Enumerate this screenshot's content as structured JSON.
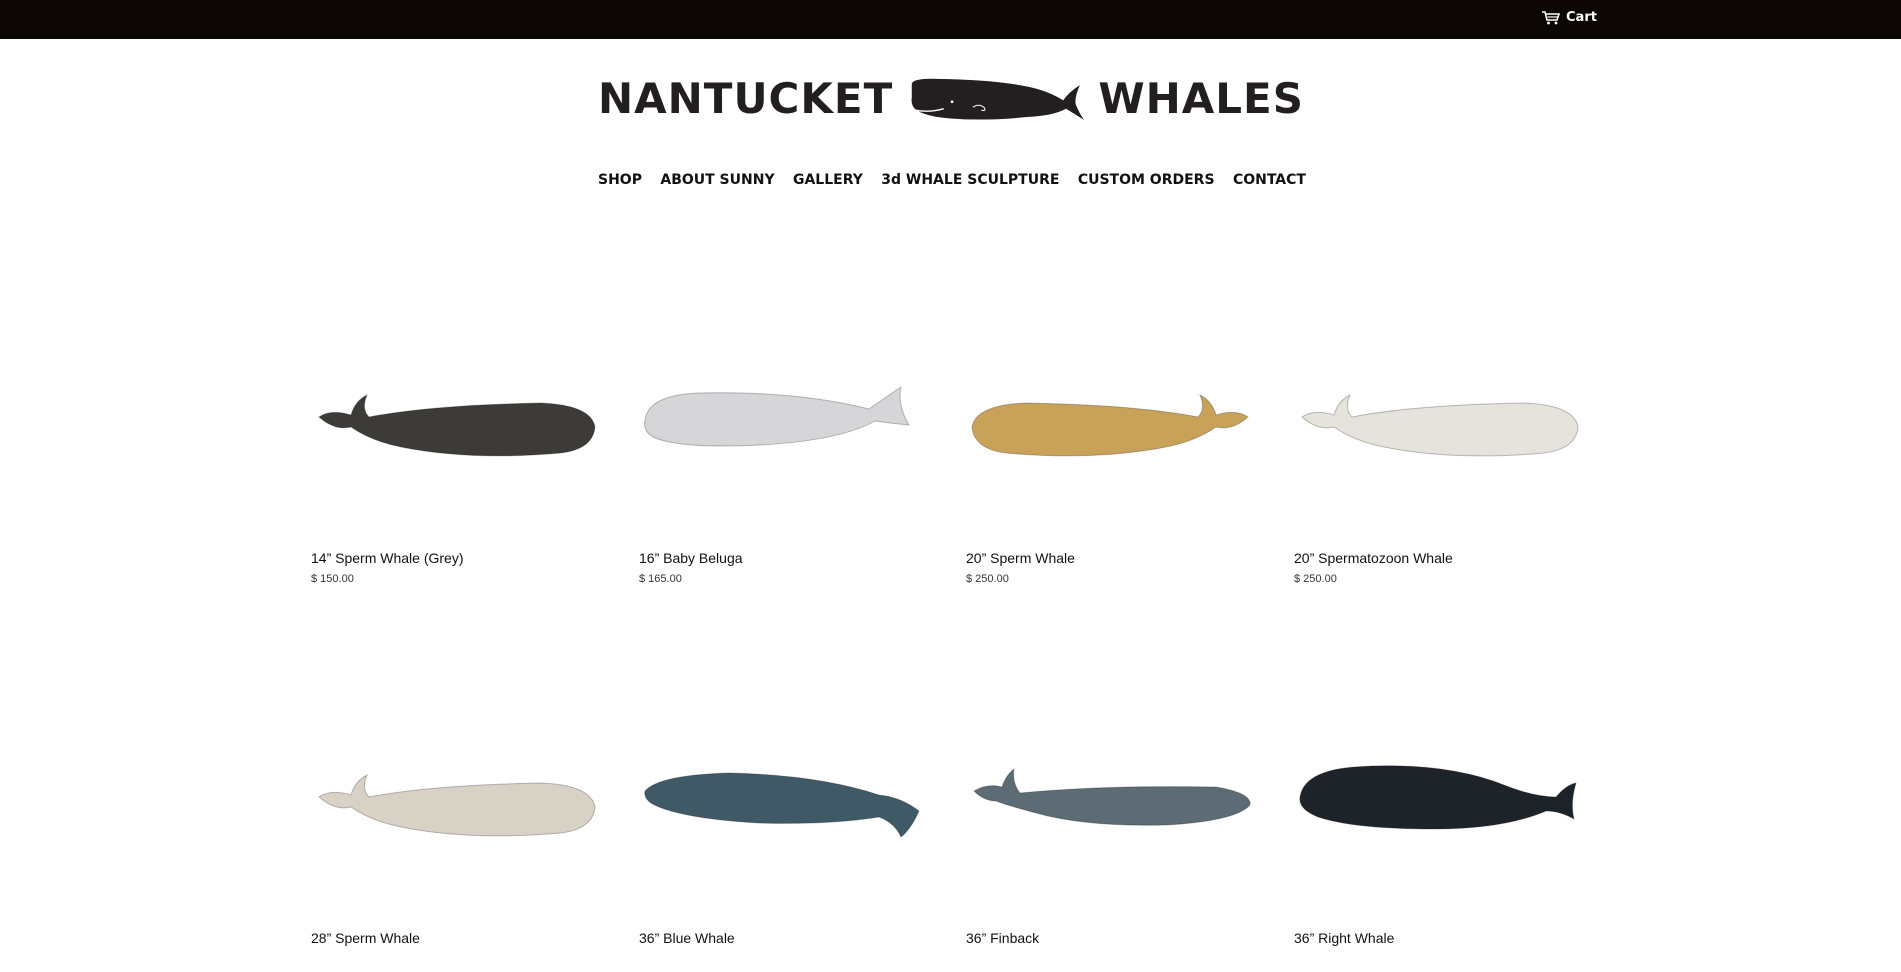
{
  "header": {
    "cart_label": "Cart",
    "cart_icon": "cart-icon"
  },
  "logo": {
    "left_word": "NANTUCKET",
    "right_word": "WHALES",
    "icon": "whale-logo-icon"
  },
  "nav": {
    "items": [
      {
        "label": "SHOP"
      },
      {
        "label": "ABOUT SUNNY"
      },
      {
        "label": "GALLERY"
      },
      {
        "label": "3d WHALE SCULPTURE"
      },
      {
        "label": "CUSTOM ORDERS"
      },
      {
        "label": "CONTACT"
      }
    ]
  },
  "products": [
    {
      "title": "14” Sperm Whale (Grey)",
      "price": "$ 150.00",
      "color": "#3d3b38",
      "kind": "sperm-left"
    },
    {
      "title": "16” Baby Beluga",
      "price": "$ 165.00",
      "color": "#d6d6d8",
      "kind": "beluga"
    },
    {
      "title": "20” Sperm Whale",
      "price": "$ 250.00",
      "color": "#c9a25a",
      "kind": "sperm-right"
    },
    {
      "title": "20” Spermatozoon Whale",
      "price": "$ 250.00",
      "color": "#e6e2dc",
      "kind": "sperm-left"
    },
    {
      "title": "28” Sperm Whale",
      "price": "",
      "color": "#d8d2c6",
      "kind": "sperm-left"
    },
    {
      "title": "36” Blue Whale",
      "price": "",
      "color": "#3f5a66",
      "kind": "blue"
    },
    {
      "title": "36” Finback",
      "price": "",
      "color": "#5d6c74",
      "kind": "fin"
    },
    {
      "title": "36” Right Whale",
      "price": "",
      "color": "#1d2328",
      "kind": "right"
    }
  ]
}
